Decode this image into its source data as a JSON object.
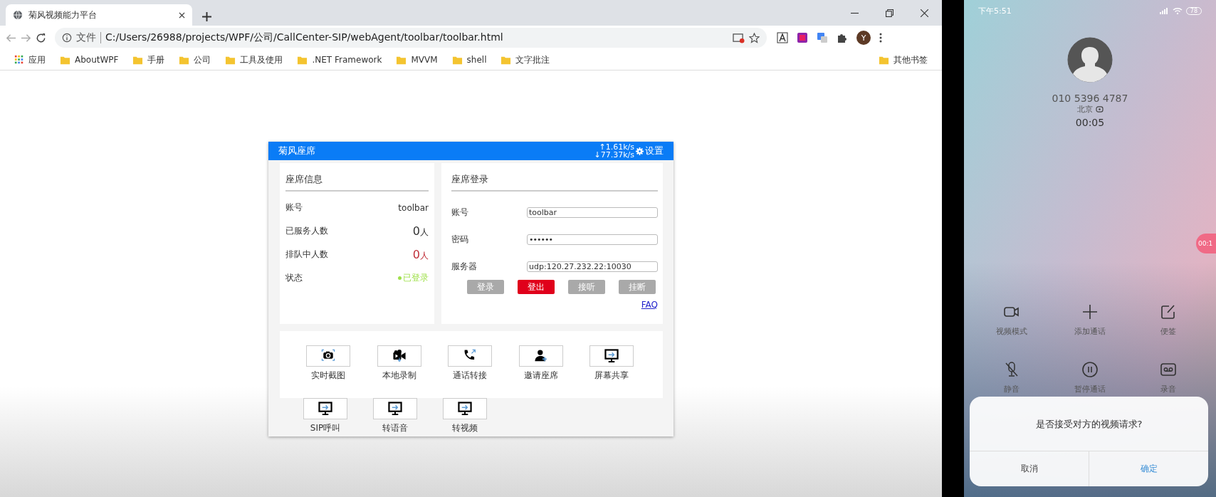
{
  "browser": {
    "tab": {
      "title": "菊风视频能力平台"
    },
    "address": {
      "prefix": "文件",
      "url": "C:/Users/26988/projects/WPF/公司/CallCenter-SIP/webAgent/toolbar/toolbar.html"
    },
    "profile": "Y",
    "bookmarks": [
      {
        "label": "应用",
        "kind": "apps"
      },
      {
        "label": "AboutWPF",
        "kind": "folder"
      },
      {
        "label": "手册",
        "kind": "folder"
      },
      {
        "label": "公司",
        "kind": "folder"
      },
      {
        "label": "工具及使用",
        "kind": "folder"
      },
      {
        "label": ".NET Framework",
        "kind": "folder"
      },
      {
        "label": "MVVM",
        "kind": "folder"
      },
      {
        "label": "shell",
        "kind": "folder"
      },
      {
        "label": "文字批注",
        "kind": "folder"
      }
    ],
    "other_bookmarks": "其他书签"
  },
  "agent": {
    "title": "菊风座席",
    "upload": "↑1.61k/s",
    "download": "↓77.37k/s",
    "settings": "设置",
    "info": {
      "heading": "座席信息",
      "rows": [
        {
          "label": "账号",
          "kind": "text",
          "value": "toolbar"
        },
        {
          "label": "已服务人数",
          "kind": "count",
          "value": "0",
          "unit": "人"
        },
        {
          "label": "排队中人数",
          "kind": "alert",
          "value": "0",
          "unit": "人"
        },
        {
          "label": "状态",
          "kind": "status",
          "value": "已登录"
        }
      ]
    },
    "login": {
      "heading": "座席登录",
      "fields": [
        {
          "label": "账号",
          "kind": "text",
          "value": "toolbar"
        },
        {
          "label": "密码",
          "kind": "password",
          "value": "••••••"
        },
        {
          "label": "服务器",
          "kind": "text",
          "value": "udp:120.27.232.22:10030"
        }
      ],
      "buttons": [
        {
          "label": "登录",
          "disabled": true
        },
        {
          "label": "登出",
          "disabled": false
        },
        {
          "label": "接听",
          "disabled": true
        },
        {
          "label": "挂断",
          "disabled": true
        }
      ],
      "link": "FAQ"
    },
    "tools": [
      {
        "label": "实时截图",
        "kind": "camera"
      },
      {
        "label": "本地录制",
        "kind": "video"
      },
      {
        "label": "通话转接",
        "kind": "phone"
      },
      {
        "label": "邀请座席",
        "kind": "user"
      },
      {
        "label": "屏幕共享",
        "kind": "screen"
      }
    ],
    "extra_tools": [
      {
        "label": "SIP呼叫",
        "kind": "screen"
      },
      {
        "label": "转语音",
        "kind": "screen"
      },
      {
        "label": "转视频",
        "kind": "screen"
      }
    ]
  },
  "phone": {
    "time": "下午5:51",
    "battery": "78",
    "number": "010 5396 4787",
    "location": "北京",
    "duration": "00:05",
    "bubble": "00:1",
    "actions": [
      {
        "label": "视频模式",
        "kind": "video"
      },
      {
        "label": "添加通话",
        "kind": "plus"
      },
      {
        "label": "便签",
        "kind": "note"
      },
      {
        "label": "静音",
        "kind": "mute"
      },
      {
        "label": "暂停通话",
        "kind": "pause"
      },
      {
        "label": "录音",
        "kind": "record"
      }
    ],
    "dialog": {
      "message": "是否接受对方的视频请求?",
      "cancel": "取消",
      "confirm": "确定"
    }
  }
}
